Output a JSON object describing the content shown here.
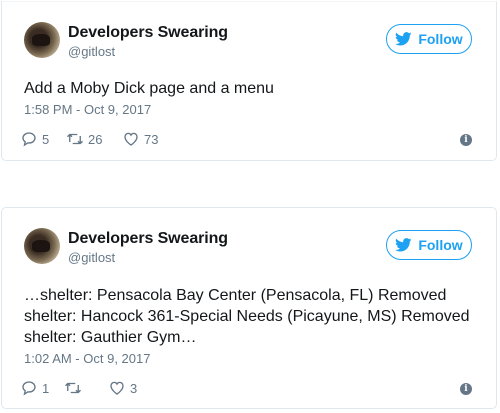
{
  "tweets": [
    {
      "display_name": "Developers Swearing",
      "username": "@gitlost",
      "follow_label": "Follow",
      "text": "Add a Moby Dick page and a menu",
      "timestamp": "1:58 PM - Oct 9, 2017",
      "replies": "5",
      "retweets": "26",
      "likes": "73"
    },
    {
      "display_name": "Developers Swearing",
      "username": "@gitlost",
      "follow_label": "Follow",
      "text": "…shelter: Pensacola Bay Center (Pensacola, FL) Removed\nshelter: Hancock 361-Special Needs (Picayune, MS) Removed\nshelter: Gauthier Gym…",
      "timestamp": "1:02 AM - Oct 9, 2017",
      "replies": "1",
      "retweets": "",
      "likes": "3"
    }
  ],
  "colors": {
    "accent": "#1da1f2",
    "muted": "#657786",
    "text": "#14171a",
    "border": "#e1e8ed"
  },
  "icons": {
    "follow": "twitter-bird-icon",
    "reply": "reply-icon",
    "retweet": "retweet-icon",
    "like": "heart-icon",
    "info": "info-icon"
  }
}
